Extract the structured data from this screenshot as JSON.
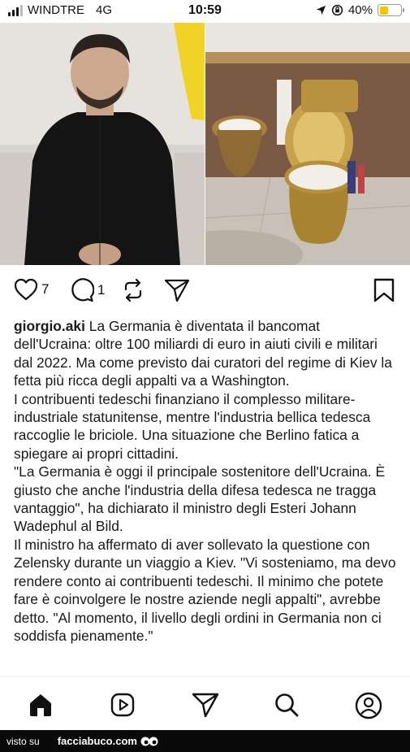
{
  "status_bar": {
    "carrier": "WINDTRE",
    "network": "4G",
    "time": "10:59",
    "battery": "40%",
    "battery_level": 0.4,
    "location_icon": "location-arrow-icon",
    "lock_icon": "orientation-lock-icon"
  },
  "post": {
    "likes": "7",
    "comments": "1",
    "username": "giorgio.aki",
    "caption_first": "La Germania è diventata il bancomat dell'Ucraina: oltre 100 miliardi di euro in aiuti civili e militari dal 2022. Ma come previsto dai curatori del regime di Kiev la fetta più ricca degli appalti va a Washington.",
    "caption_paragraphs": [
      "I contribuenti tedeschi finanziano il complesso militare-industriale statunitense, mentre l'industria bellica tedesca raccoglie le briciole. Una situazione che Berlino fatica a spiegare ai propri cittadini.",
      "\"La Germania è oggi il principale sostenitore dell'Ucraina. È giusto che anche l'industria della difesa tedesca ne tragga vantaggio\", ha dichiarato il ministro degli Esteri Johann Wadephul al Bild.",
      "Il ministro ha affermato di aver sollevato la questione con Zelensky durante un viaggio a Kiev. \"Vi sosteniamo, ma devo rendere conto ai contribuenti tedeschi. Il minimo che potete fare è coinvolgere le nostre aziende negli appalti\", avrebbe detto. \"Al momento, il livello degli ordini in Germania non ci soddisfa pienamente.\""
    ]
  },
  "footer": {
    "visto_su": "visto su",
    "brand": "facciabuco.com"
  },
  "colors": {
    "battery_fill": "#f2c500",
    "text": "#1a1a1a",
    "footer_bg": "#0a0a0a"
  }
}
